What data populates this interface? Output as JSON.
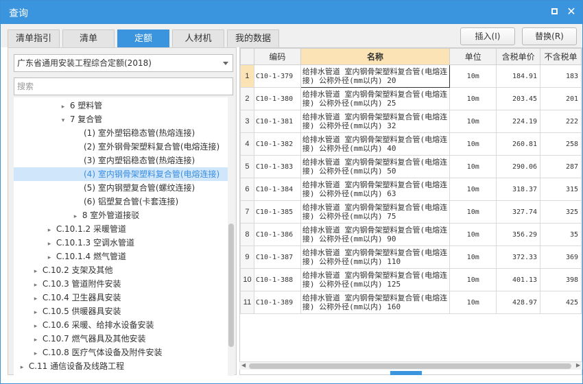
{
  "window": {
    "title": "查询"
  },
  "tabs": [
    "清单指引",
    "清单",
    "定额",
    "人材机",
    "我的数据"
  ],
  "active_tab": "定额",
  "buttons": {
    "insert": "插入(I)",
    "replace": "替换(R)"
  },
  "left": {
    "select_value": "广东省通用安装工程综合定额(2018)",
    "search_placeholder": "搜索",
    "tree": [
      {
        "arrow": "▸",
        "label": "6 塑料管"
      },
      {
        "arrow": "▾",
        "label": "7 复合管"
      },
      {
        "arrow": "",
        "label": "(1) 室外塑铝稳态管(热熔连接)"
      },
      {
        "arrow": "",
        "label": "(2) 室外钢骨架塑料复合管(电熔连接)"
      },
      {
        "arrow": "",
        "label": "(3) 室内塑铝稳态管(热熔连接)"
      },
      {
        "arrow": "",
        "label": "(4) 室内钢骨架塑料复合管(电熔连接)"
      },
      {
        "arrow": "",
        "label": "(5) 室内钢塑复合管(螺纹连接)"
      },
      {
        "arrow": "",
        "label": "(6) 铝塑复合管(卡套连接)"
      },
      {
        "arrow": "▸",
        "label": "8 室外管道接驳"
      },
      {
        "arrow": "▸",
        "label": "C.10.1.2 采暖管道"
      },
      {
        "arrow": "▸",
        "label": "C.10.1.3 空调水管道"
      },
      {
        "arrow": "▸",
        "label": "C.10.1.4 燃气管道"
      },
      {
        "arrow": "▸",
        "label": "C.10.2 支架及其他"
      },
      {
        "arrow": "▸",
        "label": "C.10.3 管道附件安装"
      },
      {
        "arrow": "▸",
        "label": "C.10.4 卫生器具安装"
      },
      {
        "arrow": "▸",
        "label": "C.10.5 供暖器具安装"
      },
      {
        "arrow": "▸",
        "label": "C.10.6 采暖、给排水设备安装"
      },
      {
        "arrow": "▸",
        "label": "C.10.7 燃气器具及其他安装"
      },
      {
        "arrow": "▸",
        "label": "C.10.8 医疗气体设备及附件安装"
      },
      {
        "arrow": "▸",
        "label": "C.11 通信设备及线路工程"
      }
    ]
  },
  "grid": {
    "headers": [
      "",
      "编码",
      "名称",
      "单位",
      "含税单价",
      "不含税单"
    ],
    "rows": [
      {
        "no": "1",
        "code": "C10-1-379",
        "name": "给排水管道 室内钢骨架塑料复合管(电熔连接) 公称外径(mm以内) 20",
        "unit": "10m",
        "price": "184.91",
        "price2": "183"
      },
      {
        "no": "2",
        "code": "C10-1-380",
        "name": "给排水管道 室内钢骨架塑料复合管(电熔连接) 公称外径(mm以内) 25",
        "unit": "10m",
        "price": "203.45",
        "price2": "201"
      },
      {
        "no": "3",
        "code": "C10-1-381",
        "name": "给排水管道 室内钢骨架塑料复合管(电熔连接) 公称外径(mm以内) 32",
        "unit": "10m",
        "price": "224.19",
        "price2": "222"
      },
      {
        "no": "4",
        "code": "C10-1-382",
        "name": "给排水管道 室内钢骨架塑料复合管(电熔连接) 公称外径(mm以内) 40",
        "unit": "10m",
        "price": "260.81",
        "price2": "258"
      },
      {
        "no": "5",
        "code": "C10-1-383",
        "name": "给排水管道 室内钢骨架塑料复合管(电熔连接) 公称外径(mm以内) 50",
        "unit": "10m",
        "price": "290.06",
        "price2": "287"
      },
      {
        "no": "6",
        "code": "C10-1-384",
        "name": "给排水管道 室内钢骨架塑料复合管(电熔连接) 公称外径(mm以内) 63",
        "unit": "10m",
        "price": "318.37",
        "price2": "315"
      },
      {
        "no": "7",
        "code": "C10-1-385",
        "name": "给排水管道 室内钢骨架塑料复合管(电熔连接) 公称外径(mm以内) 75",
        "unit": "10m",
        "price": "327.74",
        "price2": "325"
      },
      {
        "no": "8",
        "code": "C10-1-386",
        "name": "给排水管道 室内钢骨架塑料复合管(电熔连接) 公称外径(mm以内) 90",
        "unit": "10m",
        "price": "356.29",
        "price2": "35"
      },
      {
        "no": "9",
        "code": "C10-1-387",
        "name": "给排水管道 室内钢骨架塑料复合管(电熔连接) 公称外径(mm以内) 110",
        "unit": "10m",
        "price": "372.33",
        "price2": "369"
      },
      {
        "no": "10",
        "code": "C10-1-388",
        "name": "给排水管道 室内钢骨架塑料复合管(电熔连接) 公称外径(mm以内) 125",
        "unit": "10m",
        "price": "401.13",
        "price2": "398"
      },
      {
        "no": "11",
        "code": "C10-1-389",
        "name": "给排水管道 室内钢骨架塑料复合管(电熔连接) 公称外径(mm以内) 160",
        "unit": "10m",
        "price": "428.97",
        "price2": "425"
      }
    ]
  },
  "colors": {
    "accent": "#3a94de",
    "selected_row": "#cfe6fb",
    "header_highlight": "#fbe3b5"
  }
}
